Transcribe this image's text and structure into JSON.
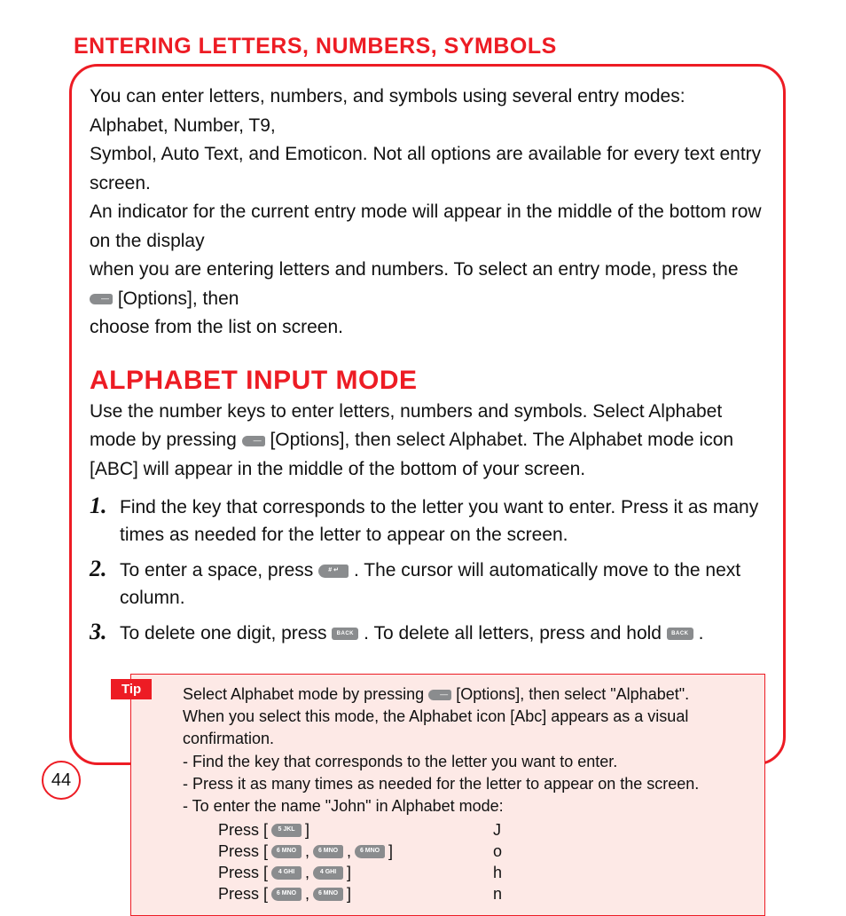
{
  "title": "ENTERING LETTERS, NUMBERS, SYMBOLS",
  "intro": {
    "l1": "You can enter letters, numbers, and symbols using several entry modes: Alphabet, Number, T9,",
    "l2": "Symbol, Auto Text, and Emoticon.  Not all options are available for every text entry screen.",
    "l3": "An indicator for the current entry mode will appear in the middle of the bottom row on the display",
    "l4a": "when you are entering letters and numbers.  To select an entry mode, press the ",
    "l4b": " [Options], then",
    "l5": "choose from the list on screen."
  },
  "section_heading": "ALPHABET INPUT MODE",
  "alpha_intro": {
    "l1a": "Use the number keys to enter letters, numbers and symbols.  Select Alphabet mode by pressing ",
    "l2": "[Options], then select Alphabet.  The Alphabet mode icon [ABC] will appear in the middle of the",
    "l3": "bottom of your screen."
  },
  "steps": [
    {
      "num": "1.",
      "l1": "Find the key that corresponds to the letter you want to enter.  Press it as many times as needed",
      "l2": "for the letter to appear on the screen."
    },
    {
      "num": "2.",
      "l1a": "To enter a space, press ",
      "l1b": " .  The cursor will automatically move to the next column."
    },
    {
      "num": "3.",
      "l1a": "To delete one digit, press ",
      "l1b": " .  To delete all letters, press and hold ",
      "l1c": " ."
    }
  ],
  "tip": {
    "label": "Tip",
    "l1a": "Select Alphabet mode by pressing ",
    "l1b": " [Options], then select \"Alphabet\".",
    "l2": "When you select this mode, the Alphabet icon [Abc] appears as a visual confirmation.",
    "l3": "- Find the key that corresponds to the letter you want to enter.",
    "l4": "- Press it as many times as needed for the letter to appear on the screen.",
    "l5": "- To enter the name \"John\" in Alphabet mode:",
    "press_label": "Press [",
    "press_close": "]",
    "comma": " , ",
    "rows": [
      {
        "keys": [
          "5 JKL"
        ],
        "out": "J"
      },
      {
        "keys": [
          "6 MNO",
          "6 MNO",
          "6 MNO"
        ],
        "out": "o"
      },
      {
        "keys": [
          "4 GHI",
          "4 GHI"
        ],
        "out": "h"
      },
      {
        "keys": [
          "6 MNO",
          "6 MNO"
        ],
        "out": "n"
      }
    ]
  },
  "keys": {
    "softkey": "options-softkey",
    "pound": "# ↵",
    "back": "BACK"
  },
  "page_number": "44"
}
